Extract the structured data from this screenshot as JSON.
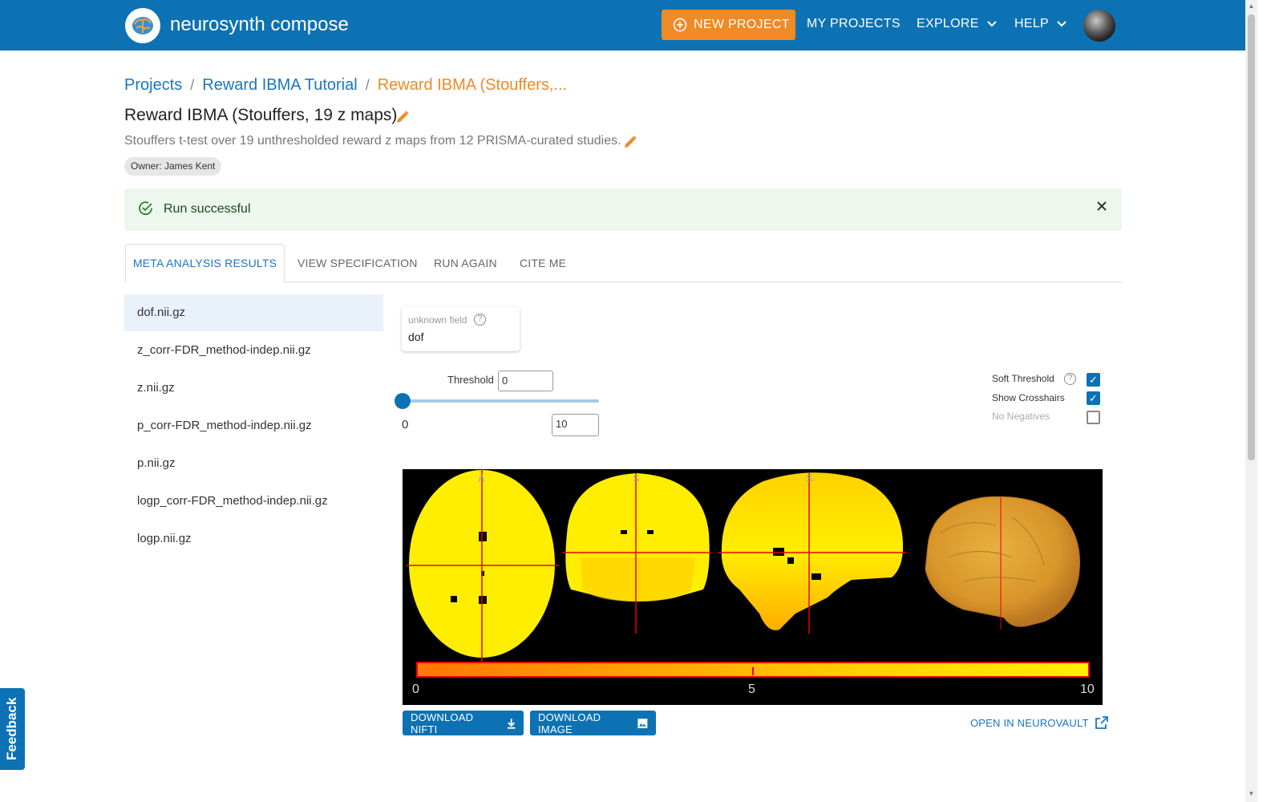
{
  "app": {
    "brand": "neurosynth compose",
    "nav": {
      "new_project": "NEW PROJECT",
      "my_projects": "MY PROJECTS",
      "explore": "EXPLORE",
      "help": "HELP"
    }
  },
  "breadcrumb": {
    "items": [
      "Projects",
      "Reward IBMA Tutorial"
    ],
    "current": "Reward IBMA (Stouffers,..."
  },
  "page": {
    "title": "Reward IBMA (Stouffers, 19 z maps)",
    "description": "Stouffers t-test over 19 unthresholded reward z maps from 12 PRISMA-curated studies.",
    "owner": "Owner: James Kent"
  },
  "alert": {
    "text": "Run successful",
    "status_color": "#2e7d32"
  },
  "tabs": [
    {
      "label": "META ANALYSIS RESULTS",
      "active": true
    },
    {
      "label": "VIEW SPECIFICATION",
      "active": false
    },
    {
      "label": "RUN AGAIN",
      "active": false
    },
    {
      "label": "CITE ME",
      "active": false
    }
  ],
  "files": [
    {
      "name": "dof.nii.gz",
      "selected": true
    },
    {
      "name": "z_corr-FDR_method-indep.nii.gz",
      "selected": false
    },
    {
      "name": "z.nii.gz",
      "selected": false
    },
    {
      "name": "p_corr-FDR_method-indep.nii.gz",
      "selected": false
    },
    {
      "name": "p.nii.gz",
      "selected": false
    },
    {
      "name": "logp_corr-FDR_method-indep.nii.gz",
      "selected": false
    },
    {
      "name": "logp.nii.gz",
      "selected": false
    }
  ],
  "field": {
    "label": "unknown field",
    "value": "dof"
  },
  "viewer_controls": {
    "threshold_label": "Threshold",
    "threshold_value": "0",
    "min_value": "0",
    "max_value": "10",
    "soft_threshold": {
      "label": "Soft Threshold",
      "checked": true
    },
    "show_crosshairs": {
      "label": "Show Crosshairs",
      "checked": true
    },
    "no_negatives": {
      "label": "No Negatives",
      "checked": false
    }
  },
  "viewer": {
    "orientation_labels": [
      "A",
      "S",
      "S"
    ],
    "colorbar_ticks": [
      "0",
      "5",
      "10"
    ],
    "colormap_colors": [
      "#ff7700",
      "#ffd200",
      "#fff000"
    ]
  },
  "actions": {
    "download_nifti": "DOWNLOAD NIFTI",
    "download_image": "DOWNLOAD IMAGE",
    "open_neurovault": "OPEN IN NEUROVAULT"
  },
  "feedback": "Feedback",
  "colors": {
    "primary": "#0d72b4",
    "accent": "#ef8a24"
  }
}
